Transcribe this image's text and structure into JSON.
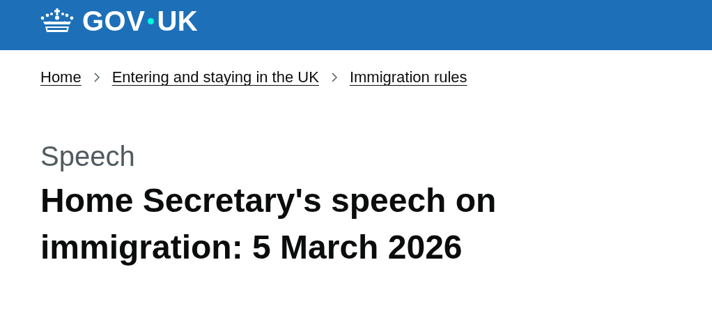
{
  "header": {
    "logo": {
      "parts": [
        "GOV",
        "UK"
      ]
    }
  },
  "breadcrumbs": [
    {
      "label": "Home"
    },
    {
      "label": "Entering and staying in the UK"
    },
    {
      "label": "Immigration rules"
    }
  ],
  "caption": "Speech",
  "title": "Home Secretary's speech on immigration: 5 March 2026"
}
